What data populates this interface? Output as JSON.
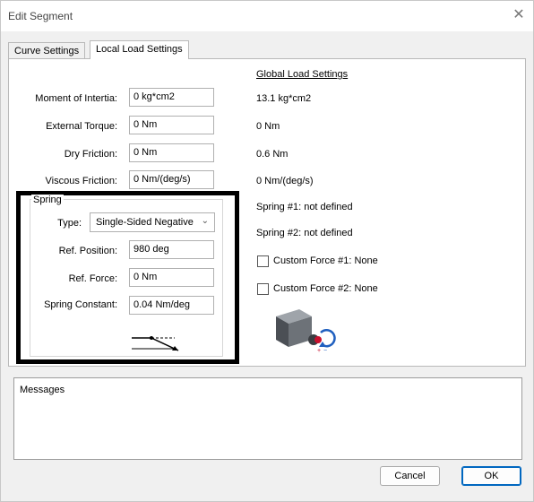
{
  "window": {
    "title": "Edit Segment"
  },
  "tabs": [
    {
      "label": "Curve Settings"
    },
    {
      "label": "Local Load Settings"
    }
  ],
  "global": {
    "heading": "Global Load Settings",
    "moment": "13.1 kg*cm2",
    "torque": "0 Nm",
    "dry_friction": "0.6 Nm",
    "viscous_friction": "0 Nm/(deg/s)",
    "spring1": "Spring #1: not defined",
    "spring2": "Spring #2: not defined"
  },
  "fields": {
    "moment": {
      "label": "Moment of Intertia:",
      "value": "0 kg*cm2"
    },
    "torque": {
      "label": "External Torque:",
      "value": "0 Nm"
    },
    "dry": {
      "label": "Dry Friction:",
      "value": "0 Nm"
    },
    "viscous": {
      "label": "Viscous Friction:",
      "value": "0 Nm/(deg/s)"
    }
  },
  "spring": {
    "title": "Spring",
    "type_label": "Type:",
    "type_value": "Single-Sided Negative",
    "position_label": "Ref. Position:",
    "position_value": "980 deg",
    "force_label": "Ref. Force:",
    "force_value": "0 Nm",
    "constant_label": "Spring Constant:",
    "constant_value": "0.04 Nm/deg"
  },
  "custom": {
    "force1": "Custom Force #1: None",
    "force2": "Custom Force #2: None"
  },
  "messages": {
    "label": "Messages"
  },
  "buttons": {
    "cancel": "Cancel",
    "ok": "OK"
  },
  "icons": {
    "close": "close-icon",
    "spring_diagram": "spring-diagram-icon",
    "motor": "motor-icon"
  }
}
